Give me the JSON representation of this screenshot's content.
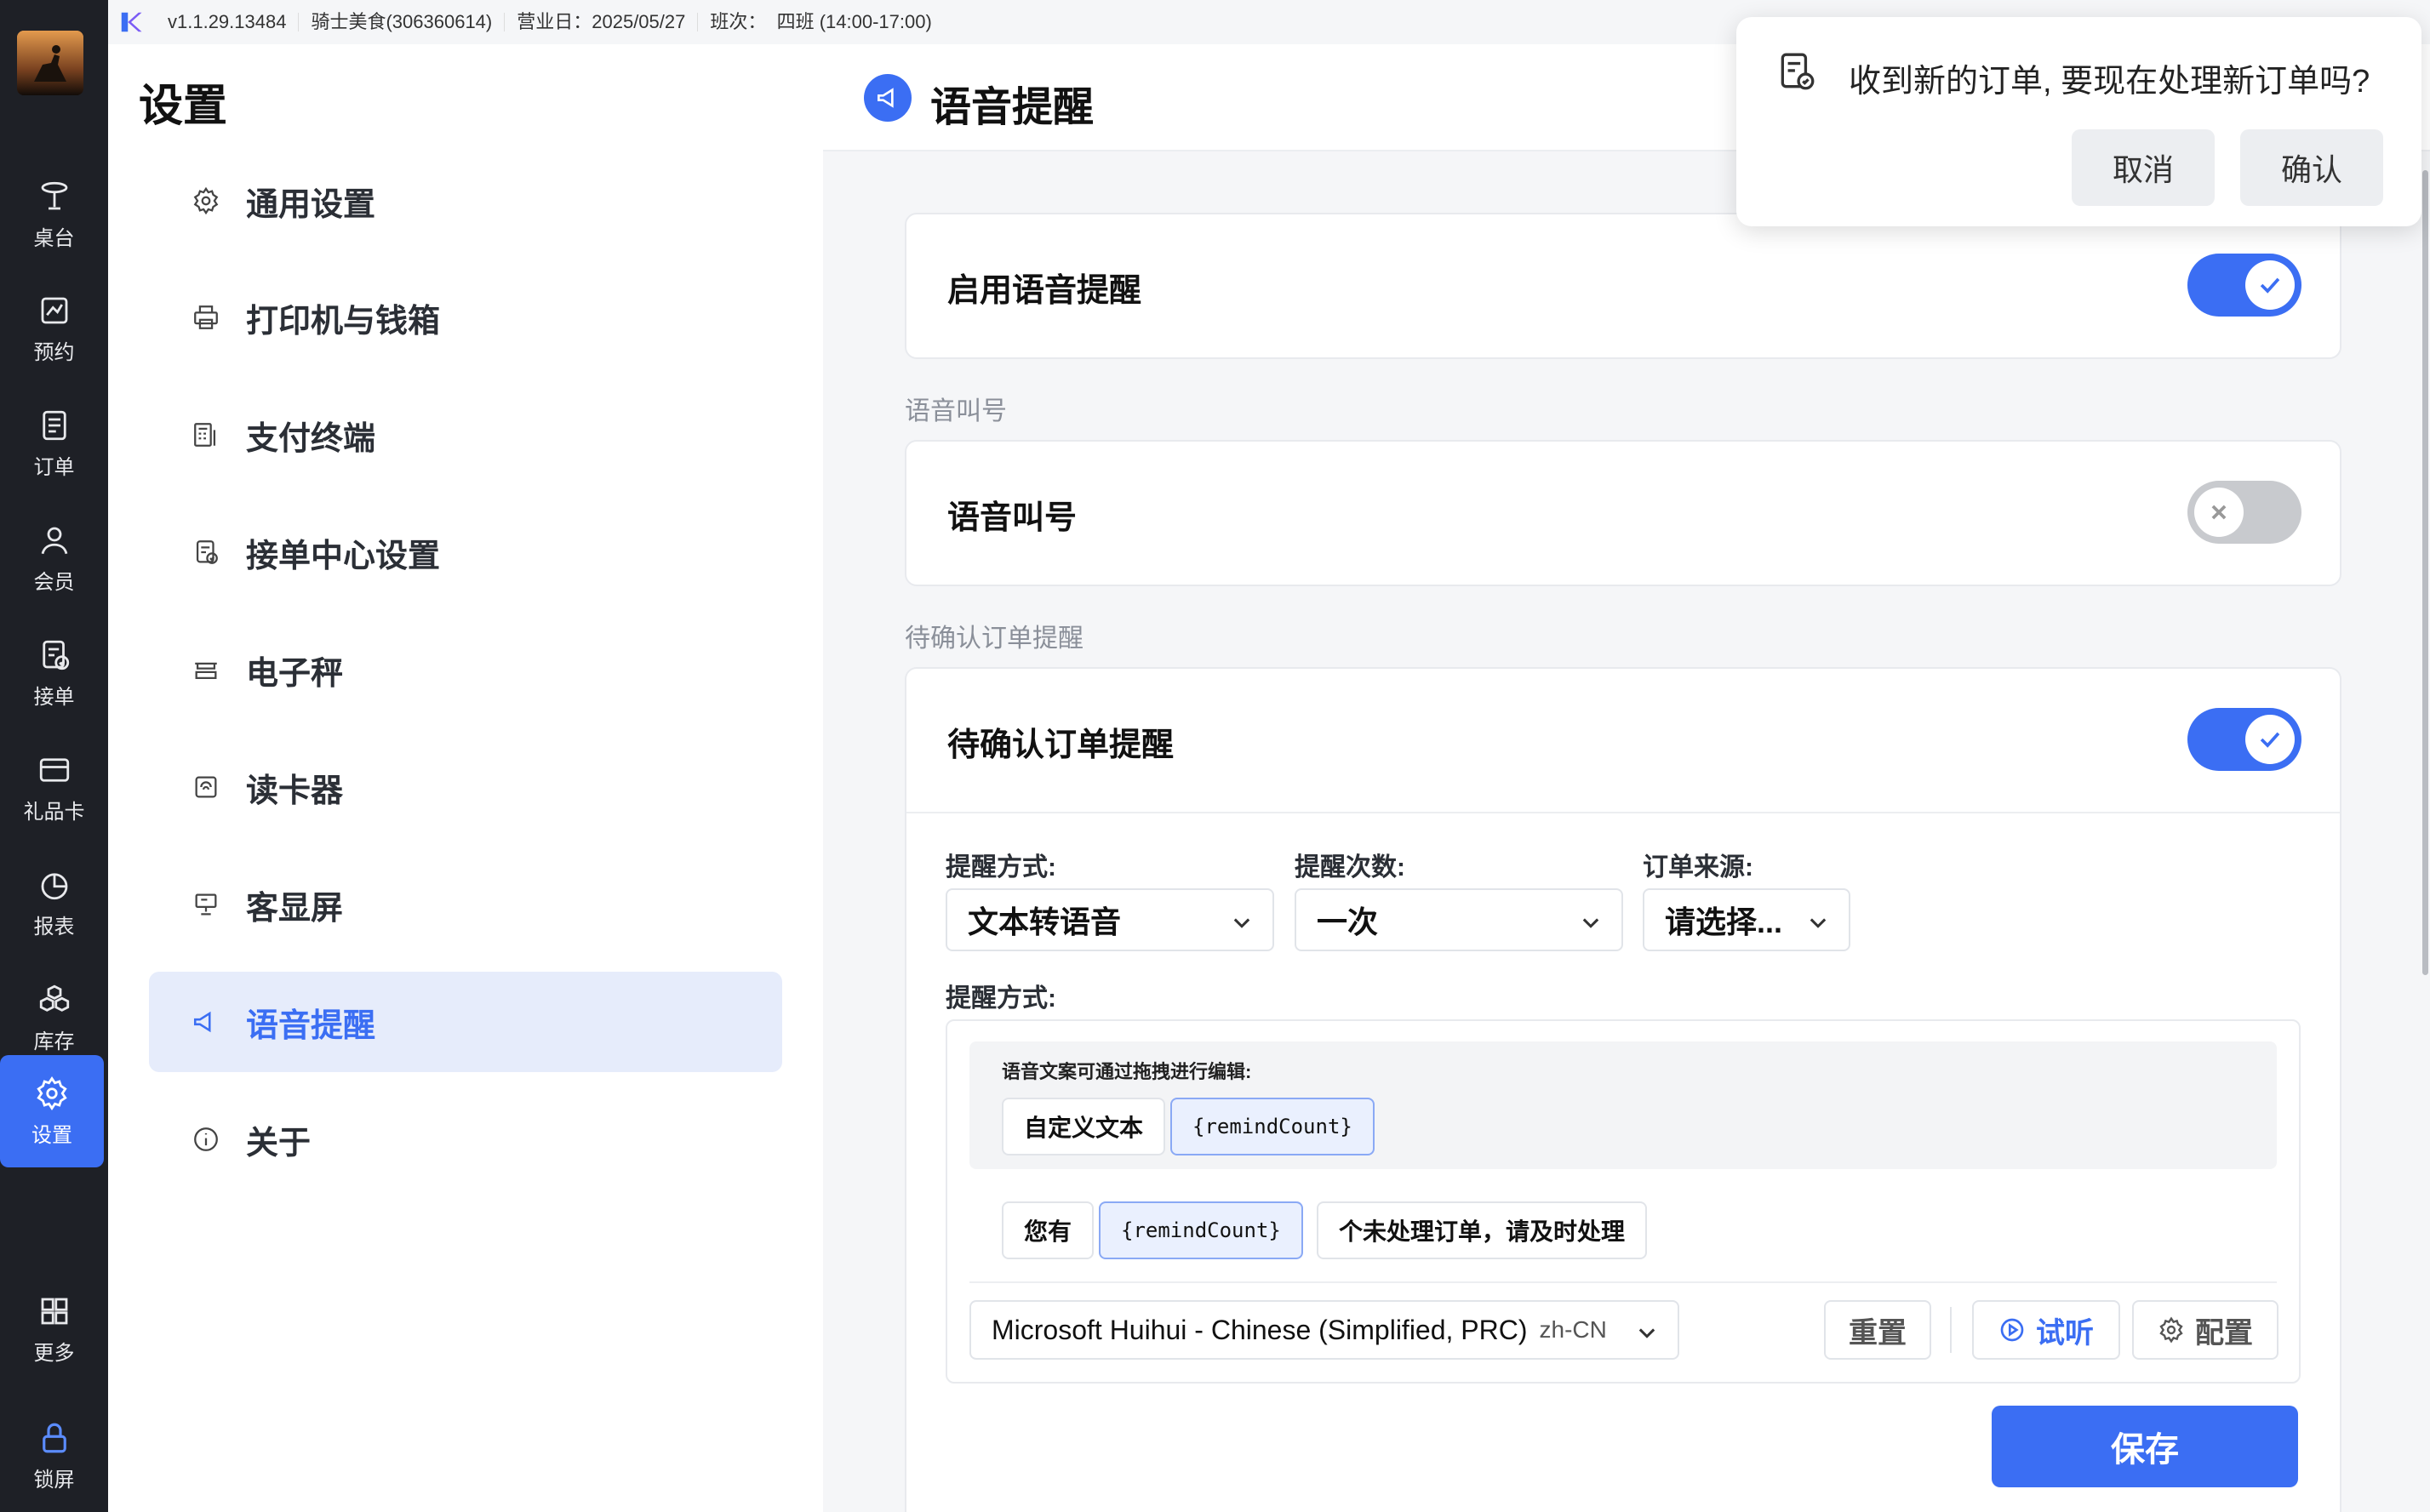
{
  "topbar": {
    "version": "v1.1.29.13484",
    "store": "骑士美食(306360614)",
    "business_day": "营业日：2025/05/27",
    "shift_label": "班次：",
    "shift": "四班 (14:00-17:00)"
  },
  "rail": {
    "items": [
      {
        "label": "桌台",
        "icon": "dining-table-icon"
      },
      {
        "label": "预约",
        "icon": "reservation-icon"
      },
      {
        "label": "订单",
        "icon": "order-icon"
      },
      {
        "label": "会员",
        "icon": "member-icon"
      },
      {
        "label": "接单",
        "icon": "accept-order-icon"
      },
      {
        "label": "礼品卡",
        "icon": "gift-card-icon"
      },
      {
        "label": "报表",
        "icon": "report-icon"
      },
      {
        "label": "库存",
        "icon": "inventory-icon"
      },
      {
        "label": "设置",
        "icon": "gear-icon",
        "active": true
      },
      {
        "label": "更多",
        "icon": "grid-icon"
      },
      {
        "label": "锁屏",
        "icon": "lock-icon"
      }
    ]
  },
  "settings_nav": {
    "title": "设置",
    "items": [
      {
        "label": "通用设置",
        "icon": "gear-icon"
      },
      {
        "label": "打印机与钱箱",
        "icon": "printer-icon"
      },
      {
        "label": "支付终端",
        "icon": "pos-terminal-icon"
      },
      {
        "label": "接单中心设置",
        "icon": "order-center-icon"
      },
      {
        "label": "电子秤",
        "icon": "scale-icon"
      },
      {
        "label": "读卡器",
        "icon": "card-reader-icon"
      },
      {
        "label": "客显屏",
        "icon": "customer-display-icon"
      },
      {
        "label": "语音提醒",
        "icon": "megaphone-icon",
        "active": true
      },
      {
        "label": "关于",
        "icon": "info-icon"
      }
    ]
  },
  "main": {
    "title": "语音提醒",
    "enable_voice": {
      "label": "启用语音提醒",
      "on": true
    },
    "voice_call_section": "语音叫号",
    "voice_call": {
      "label": "语音叫号",
      "on": false
    },
    "pending_section": "待确认订单提醒",
    "pending": {
      "label": "待确认订单提醒",
      "on": true,
      "remind_method_label": "提醒方式:",
      "remind_method_value": "文本转语音",
      "remind_count_label": "提醒次数:",
      "remind_count_value": "一次",
      "order_source_label": "订单来源:",
      "order_source_value": "请选择...",
      "content_label": "提醒方式:",
      "palette_hint": "语音文案可通过拖拽进行编辑:",
      "palette_chips": [
        "自定义文本",
        "{remindCount}"
      ],
      "template_chips": [
        "您有",
        "{remindCount}",
        "个未处理订单，请及时处理"
      ],
      "voice": "Microsoft Huihui - Chinese (Simplified, PRC)",
      "voice_locale": "zh-CN",
      "reset": "重置",
      "preview": "试听",
      "config": "配置"
    },
    "save": "保存"
  },
  "popup": {
    "message": "收到新的订单, 要现在处理新订单吗?",
    "cancel": "取消",
    "confirm": "确认"
  },
  "colors": {
    "accent": "#3b6ef3",
    "rail": "#1e2026",
    "active_nav_bg": "#e6ecfb"
  }
}
